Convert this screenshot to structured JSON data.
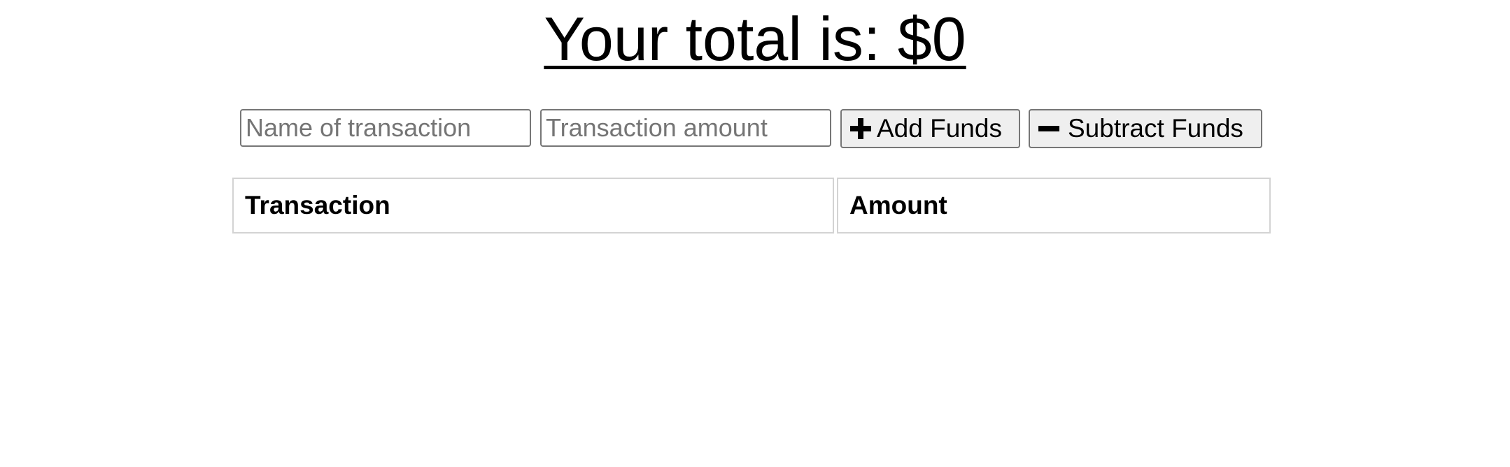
{
  "header": {
    "total_text": "Your total is: $0"
  },
  "form": {
    "name_placeholder": "Name of transaction",
    "name_value": "",
    "amount_placeholder": "Transaction amount",
    "amount_value": "",
    "add_label": "Add Funds",
    "add_icon": "plus-icon",
    "subtract_label": "Subtract Funds",
    "subtract_icon": "minus-icon"
  },
  "table": {
    "columns": [
      "Transaction",
      "Amount"
    ],
    "rows": []
  }
}
